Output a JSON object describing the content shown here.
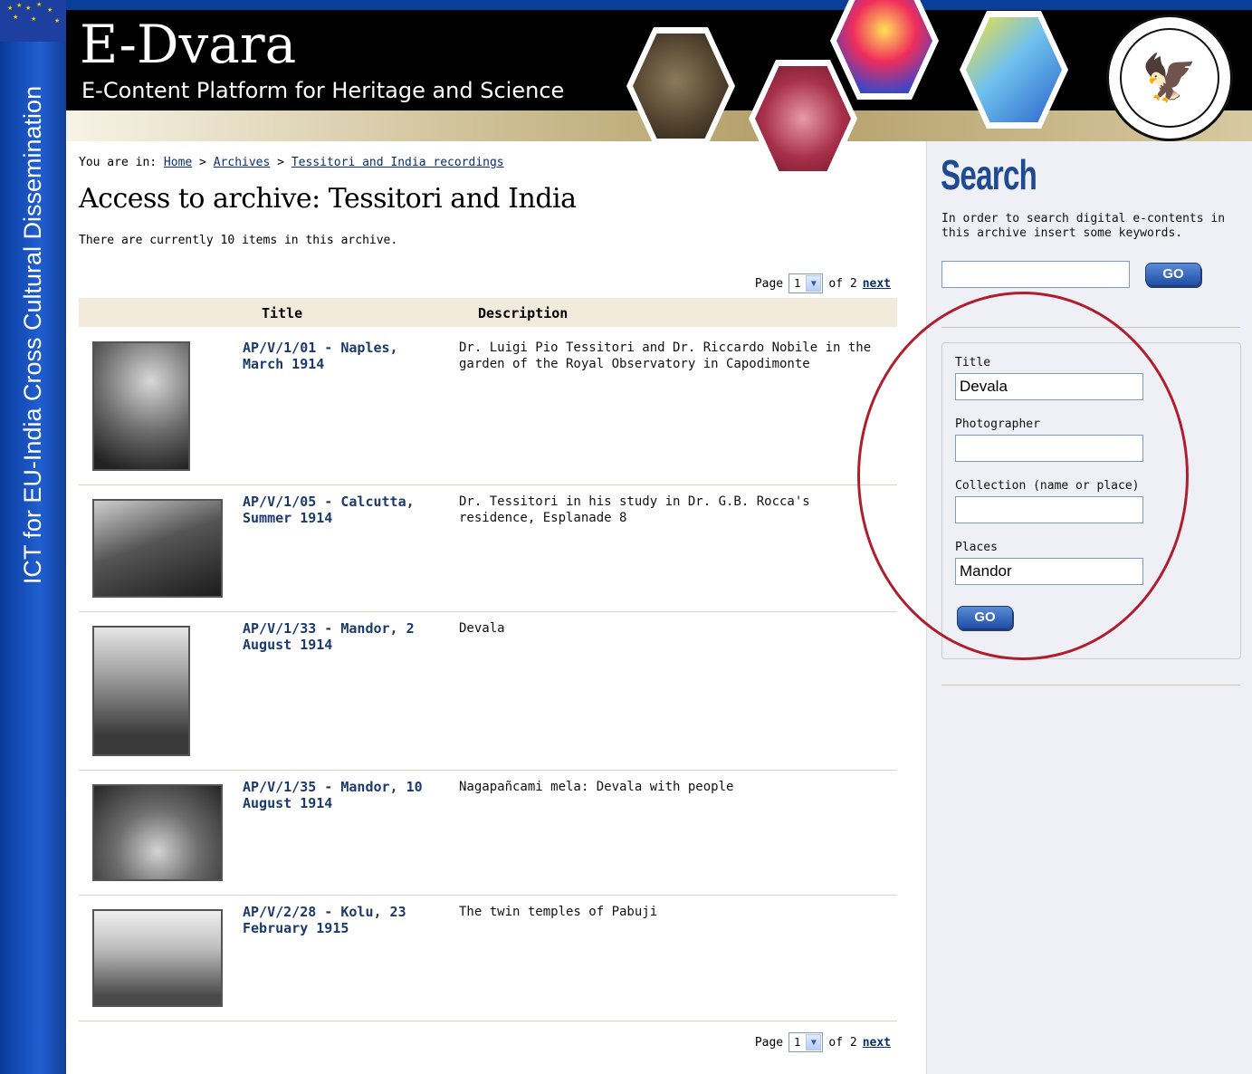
{
  "side_band": {
    "text": "ICT for EU-India Cross Cultural Dissemination"
  },
  "header": {
    "site_name": "E-Dvara",
    "tagline": "E-Content Platform for Heritage and Science",
    "seal_icon": "university-seal"
  },
  "breadcrumb": {
    "prefix": "You are in: ",
    "home": "Home",
    "sep1": " > ",
    "archives": "Archives",
    "sep2": " > ",
    "current": "Tessitori and India recordings"
  },
  "page": {
    "title": "Access to archive: Tessitori and India",
    "items_count": "There are currently 10 items in this archive."
  },
  "pager": {
    "label": "Page",
    "current": "1",
    "of": "of 2",
    "next": "next"
  },
  "table": {
    "headers": {
      "title": "Title",
      "description": "Description"
    },
    "rows": [
      {
        "title": "AP/V/1/01 - Naples, March 1914",
        "description": "Dr. Luigi Pio Tessitori and Dr. Riccardo Nobile in the garden of the Royal Observatory in Capodimonte"
      },
      {
        "title": "AP/V/1/05 - Calcutta, Summer 1914",
        "description": "Dr. Tessitori in his study in Dr. G.B. Rocca's residence, Esplanade 8"
      },
      {
        "title": "AP/V/1/33 - Mandor, 2 August 1914",
        "description": "Devala"
      },
      {
        "title": "AP/V/1/35 - Mandor, 10 August 1914",
        "description": "Nagapañcami mela: Devala with people"
      },
      {
        "title": "AP/V/2/28 - Kolu, 23 February 1915",
        "description": "The twin temples of Pabuji"
      }
    ]
  },
  "search": {
    "title": "Search",
    "help": "In order to search digital e-contents in this archive insert some keywords.",
    "quick_value": "",
    "go_label": "GO",
    "advanced": {
      "title_label": "Title",
      "title_value": "Devala",
      "photographer_label": "Photographer",
      "photographer_value": "",
      "collection_label": "Collection (name or place)",
      "collection_value": "",
      "places_label": "Places",
      "places_value": "Mandor",
      "go_label": "GO"
    }
  },
  "colors": {
    "accent_blue": "#1d4a91",
    "highlight": "#b01e2e",
    "table_header_bg": "#f2ebdc"
  }
}
